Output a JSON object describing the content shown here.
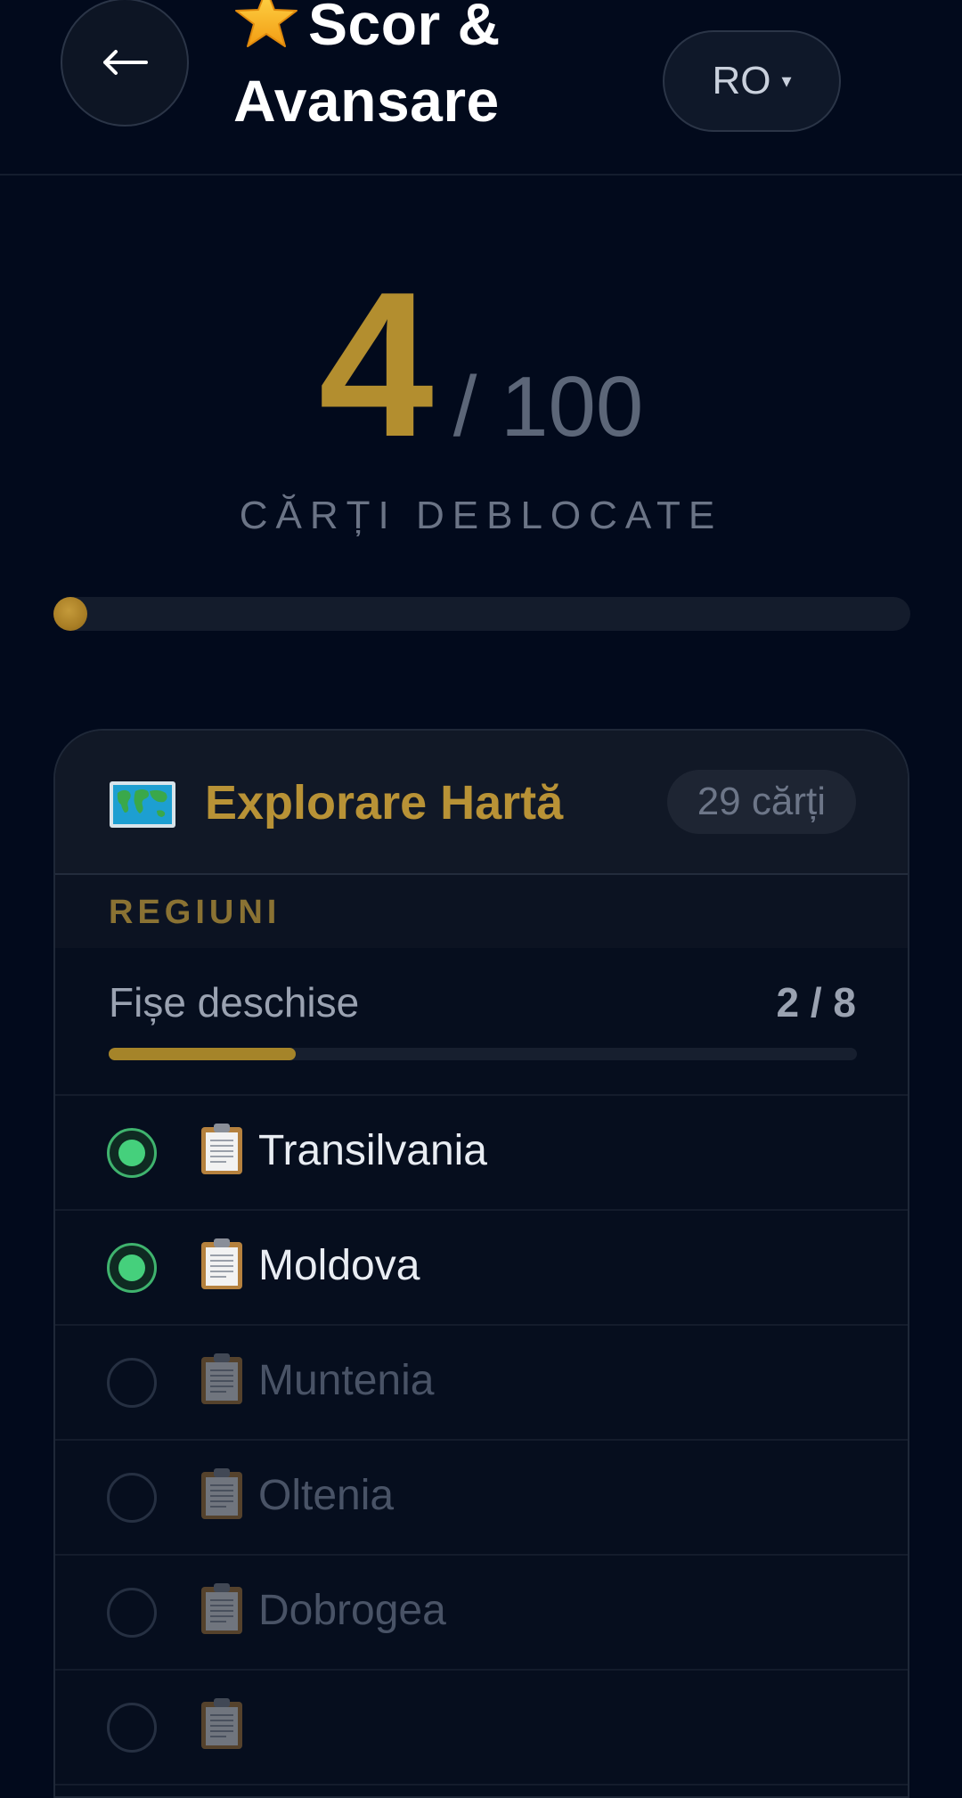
{
  "header": {
    "back_icon": "arrow-left-icon",
    "title_icon": "star-icon",
    "title": "Scor & Avansare",
    "language": "RO",
    "language_caret": "▾"
  },
  "score": {
    "unlocked": "4",
    "total": "/ 100",
    "label": "CĂRȚI DEBLOCATE",
    "progress_fraction": 0.04
  },
  "card": {
    "icon": "world-map-icon",
    "title": "Explorare Hartă",
    "badge": "29 cărți",
    "section_label": "REGIUNI",
    "files_label": "Fișe deschise",
    "files_count": "2 / 8",
    "files_fraction": 0.25,
    "regions": [
      {
        "name": "Transilvania",
        "icon": "clipboard-icon",
        "unlocked": true
      },
      {
        "name": "Moldova",
        "icon": "clipboard-icon",
        "unlocked": true
      },
      {
        "name": "Muntenia",
        "icon": "clipboard-icon",
        "unlocked": false
      },
      {
        "name": "Oltenia",
        "icon": "clipboard-icon",
        "unlocked": false
      },
      {
        "name": "Dobrogea",
        "icon": "clipboard-icon",
        "unlocked": false
      },
      {
        "name": "",
        "icon": "clipboard-icon",
        "unlocked": false
      }
    ]
  },
  "colors": {
    "background": "#020a1c",
    "accent_gold": "#b38e2f",
    "success_green": "#45d07c"
  }
}
